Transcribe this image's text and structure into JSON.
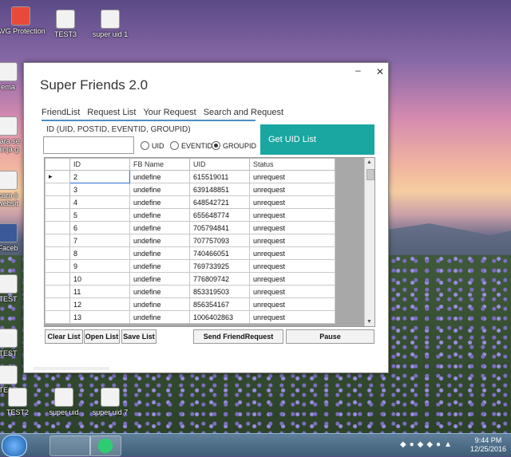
{
  "desktop": {
    "icons": [
      {
        "label": "AVG Protection"
      },
      {
        "label": "TEST3"
      },
      {
        "label": "super uid 1"
      },
      {
        "label": "ema"
      },
      {
        "label": "cara se ninja g"
      },
      {
        "label": "cara li websit"
      },
      {
        "label": "Faceb"
      },
      {
        "label": "TEST"
      },
      {
        "label": "TEST"
      },
      {
        "label": "TEST"
      },
      {
        "label": "TEST2"
      },
      {
        "label": "super uid"
      },
      {
        "label": "super uid 7"
      }
    ]
  },
  "window": {
    "title": "Super Friends 2.0",
    "tabs": [
      {
        "label": "FriendList"
      },
      {
        "label": "Request List"
      },
      {
        "label": "Your Request"
      },
      {
        "label": "Search and Request"
      }
    ],
    "id_label": "ID (UID, POSTID, EVENTID, GROUPID)",
    "id_input_value": "",
    "radios": [
      {
        "label": "UID"
      },
      {
        "label": "EVENTID"
      },
      {
        "label": "GROUPID"
      }
    ],
    "get_uid_label": "Get UID List",
    "grid": {
      "columns": [
        "ID",
        "FB Name",
        "UID",
        "Status"
      ],
      "rows": [
        [
          "2",
          "undefine",
          "615519011",
          "unrequest"
        ],
        [
          "3",
          "undefine",
          "639148851",
          "unrequest"
        ],
        [
          "4",
          "undefine",
          "648542721",
          "unrequest"
        ],
        [
          "5",
          "undefine",
          "655648774",
          "unrequest"
        ],
        [
          "6",
          "undefine",
          "705794841",
          "unrequest"
        ],
        [
          "7",
          "undefine",
          "707757093",
          "unrequest"
        ],
        [
          "8",
          "undefine",
          "740466051",
          "unrequest"
        ],
        [
          "9",
          "undefine",
          "769733925",
          "unrequest"
        ],
        [
          "10",
          "undefine",
          "776809742",
          "unrequest"
        ],
        [
          "11",
          "undefine",
          "853319503",
          "unrequest"
        ],
        [
          "12",
          "undefine",
          "856354167",
          "unrequest"
        ],
        [
          "13",
          "undefine",
          "1006402863",
          "unrequest"
        ]
      ]
    },
    "buttons": {
      "clear": "Clear List",
      "open": "Open List",
      "save": "Save List",
      "send": "Send FriendRequest",
      "pause": "Pause"
    }
  },
  "taskbar": {
    "time": "9:44 PM",
    "date": "12/25/2016"
  },
  "colors": {
    "accent": "#1aa6a1",
    "tab_underline": "#4e8fc2"
  }
}
